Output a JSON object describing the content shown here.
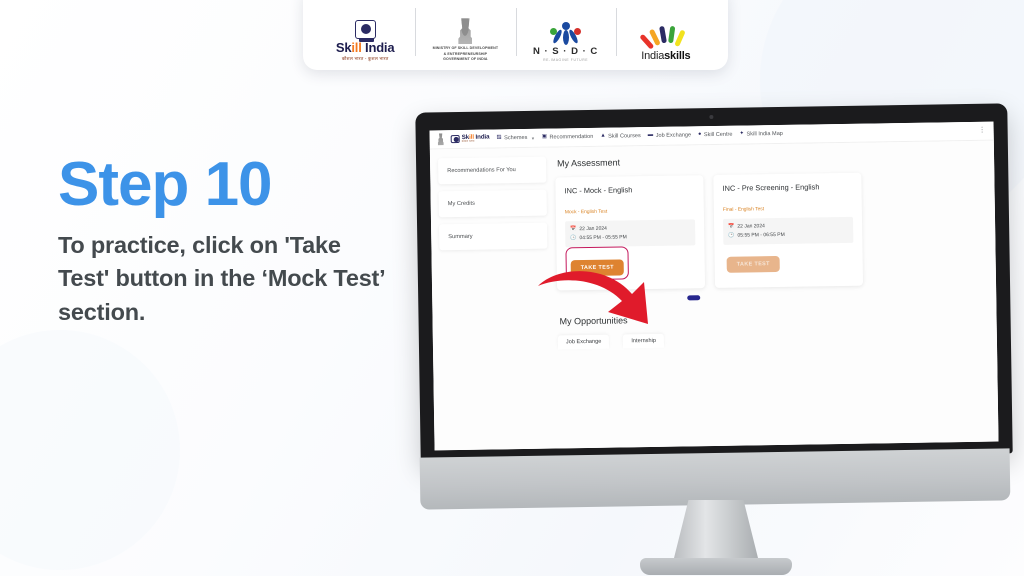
{
  "theme": {
    "accent_blue": "#3d93e8",
    "body_text": "#444a4e",
    "button_orange": "#de8330",
    "highlight_crimson": "#c4185c",
    "arrow_red": "#e01b2b",
    "pill_blue": "#27278e",
    "page_bg": "#fbfcfe"
  },
  "logo_bar": {
    "logos": [
      {
        "name": "skill-india-logo",
        "word_a": "Sk",
        "word_highlight": "ill",
        "word_b": " India",
        "subtitle": "कौशल भारत - कुशल भारत"
      },
      {
        "name": "ministry-emblem-logo",
        "line1": "MINISTRY OF SKILL DEVELOPMENT",
        "line2": "& ENTREPRENEURSHIP",
        "line3": "GOVERNMENT OF INDIA"
      },
      {
        "name": "nsdc-logo",
        "word": "N · S · D · C",
        "tagline": "RE-IMAGINE FUTURE"
      },
      {
        "name": "india-skills-logo",
        "word_a": "India",
        "word_b": "skills"
      }
    ]
  },
  "copy": {
    "step_title": "Step 10",
    "body": "To practice, click on 'Take Test' button in the ‘Mock Test’ section."
  },
  "app": {
    "navbar": {
      "brand": {
        "word_a": "Sk",
        "word_highlight": "ill",
        "word_b": " India",
        "subtitle": "कौशल भारत"
      },
      "items": [
        {
          "label": "Schemes",
          "icon": "schemes-icon",
          "glyph": "☷",
          "has_caret": true
        },
        {
          "label": "Recommendation",
          "icon": "recommendation-icon",
          "glyph": "▣",
          "has_caret": false
        },
        {
          "label": "Skill Courses",
          "icon": "graduation-cap-icon",
          "glyph": "♟",
          "has_caret": false
        },
        {
          "label": "Job Exchange",
          "icon": "briefcase-icon",
          "glyph": "▤",
          "has_caret": false
        },
        {
          "label": "Skill Centre",
          "icon": "location-pin-icon",
          "glyph": "●",
          "has_caret": false
        },
        {
          "label": "Skill India Map",
          "icon": "map-marker-icon",
          "glyph": "✦",
          "has_caret": false
        }
      ],
      "kebab_label": "⋮"
    },
    "sidebar": {
      "items": [
        {
          "label": "Recommendations For You"
        },
        {
          "label": "My Credits"
        },
        {
          "label": "Summary"
        }
      ]
    },
    "assessment": {
      "section_title": "My Assessment",
      "cards": [
        {
          "title": "INC - Mock - English",
          "subtitle": "Mock - English Test",
          "date_icon": "calendar-icon",
          "date": "22 Jan 2024",
          "time_icon": "clock-icon",
          "time": "04:55 PM - 05:55 PM",
          "button_label": "TAKE TEST",
          "button_state": "active",
          "highlighted": true
        },
        {
          "title": "INC - Pre Screening - English",
          "subtitle": "Final - English Test",
          "date_icon": "calendar-icon",
          "date": "22 Jan 2024",
          "time_icon": "clock-icon",
          "time": "05:55 PM - 06:55 PM",
          "button_label": "TAKE TEST",
          "button_state": "disabled",
          "highlighted": false
        }
      ]
    },
    "opportunities": {
      "section_title": "My Opportunities",
      "tabs": [
        {
          "label": "Job Exchange"
        },
        {
          "label": "Internship"
        }
      ]
    }
  }
}
